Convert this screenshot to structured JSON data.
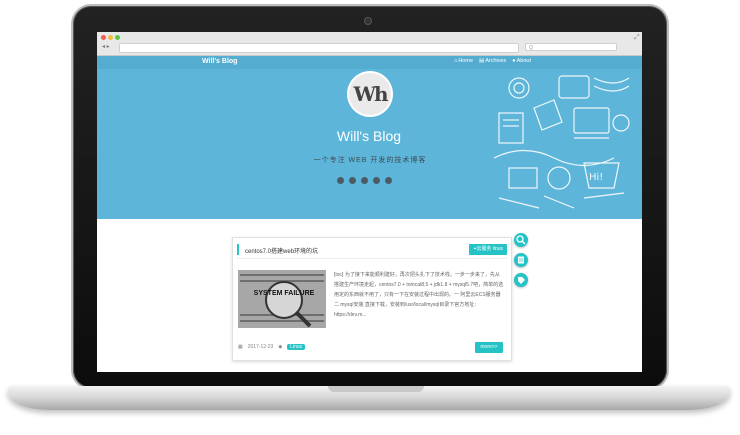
{
  "browser": {
    "search_placeholder": "Q"
  },
  "site": {
    "brand": "Will's Blog",
    "menu": [
      {
        "label": "Home",
        "icon": "home-icon"
      },
      {
        "label": "Archives",
        "icon": "archive-icon"
      },
      {
        "label": "About",
        "icon": "user-icon"
      }
    ],
    "logo_text": "Wh",
    "title": "Will's Blog",
    "tagline": "一个专注 WEB 开发的技术博客",
    "social_icons": [
      "home-icon",
      "github-icon",
      "weibo-icon",
      "qq-icon",
      "wechat-icon"
    ]
  },
  "post": {
    "title": "centos7.0搭建web环境的坑",
    "category": "云服务 linux",
    "thumbnail_text": "SYSTEM FAILURE",
    "excerpt": "[toc] 为了接下来能顺利建好，再次把头扎下了技术栈，一步一步来了，先从搭建生产环境走起，centos7.0 + tomcat8.5 + jdk1.8 + mysql5.7吧，简单的选用定的东西就不用了，只有一下在安装过程中出现的。一 阿里云ECS服务器二 mysql安装 直接下载，安装到/usr/local/mysql目录下官方地址：https://dev.m...",
    "date": "2017-12-23",
    "tag": "Linux",
    "more_label": "more>>"
  },
  "floating_buttons": [
    "search-icon",
    "book-icon",
    "tag-icon"
  ],
  "colors": {
    "hero": "#5db5d9",
    "accent": "#25c3c6"
  }
}
